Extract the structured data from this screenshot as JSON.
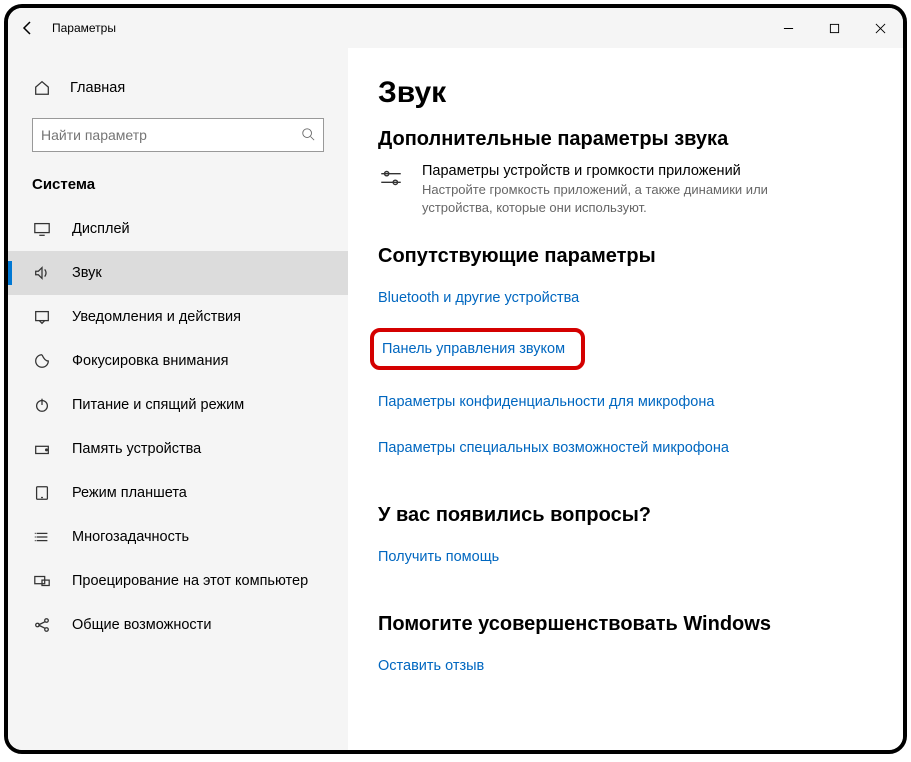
{
  "window": {
    "title": "Параметры"
  },
  "sidebar": {
    "home": "Главная",
    "search_placeholder": "Найти параметр",
    "section": "Система",
    "items": [
      {
        "label": "Дисплей",
        "icon": "display"
      },
      {
        "label": "Звук",
        "icon": "sound",
        "selected": true
      },
      {
        "label": "Уведомления и действия",
        "icon": "notifications"
      },
      {
        "label": "Фокусировка внимания",
        "icon": "focus"
      },
      {
        "label": "Питание и спящий режим",
        "icon": "power"
      },
      {
        "label": "Память устройства",
        "icon": "storage"
      },
      {
        "label": "Режим планшета",
        "icon": "tablet"
      },
      {
        "label": "Многозадачность",
        "icon": "multitask"
      },
      {
        "label": "Проецирование на этот компьютер",
        "icon": "project"
      },
      {
        "label": "Общие возможности",
        "icon": "shared"
      }
    ]
  },
  "content": {
    "page_title": "Звук",
    "adv": {
      "heading": "Дополнительные параметры звука",
      "vol_title": "Параметры устройств и громкости приложений",
      "vol_sub": "Настройте громкость приложений, а также динамики или устройства, которые они используют."
    },
    "related": {
      "heading": "Сопутствующие параметры",
      "links": [
        "Bluetooth и другие устройства",
        "Панель управления звуком",
        "Параметры конфиденциальности для микрофона",
        "Параметры специальных возможностей микрофона"
      ]
    },
    "help": {
      "heading": "У вас появились вопросы?",
      "link": "Получить помощь"
    },
    "feedback": {
      "heading": "Помогите усовершенствовать Windows",
      "link": "Оставить отзыв"
    }
  }
}
